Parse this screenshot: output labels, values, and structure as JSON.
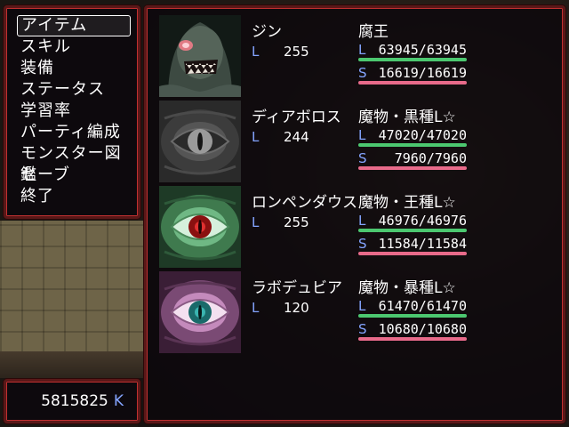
{
  "menu": {
    "items": [
      {
        "label": "アイテム",
        "selected": true
      },
      {
        "label": "スキル",
        "selected": false
      },
      {
        "label": "装備",
        "selected": false
      },
      {
        "label": "ステータス",
        "selected": false
      },
      {
        "label": "学習率",
        "selected": false
      },
      {
        "label": "パーティ編成",
        "selected": false
      },
      {
        "label": "モンスター図鑑",
        "selected": false
      },
      {
        "label": "セーブ",
        "selected": false
      },
      {
        "label": "終了",
        "selected": false
      }
    ]
  },
  "gold": {
    "value": "5815825",
    "unit": "K"
  },
  "party": {
    "members": [
      {
        "name": "ジン",
        "level_label": "L",
        "level": "255",
        "class": "腐王",
        "stat1_label": "L",
        "stat1_value": "63945/63945",
        "stat1_fill": 1.0,
        "stat2_label": "S",
        "stat2_value": "16619/16619",
        "stat2_fill": 1.0,
        "portrait": "masked-monster-face"
      },
      {
        "name": "ディアボロス",
        "level_label": "L",
        "level": "244",
        "class": "魔物・黒種L☆",
        "stat1_label": "L",
        "stat1_value": "47020/47020",
        "stat1_fill": 1.0,
        "stat2_label": "S",
        "stat2_value": "7960/7960",
        "stat2_fill": 1.0,
        "portrait": "grey-eye"
      },
      {
        "name": "ロンペンダウス",
        "level_label": "L",
        "level": "255",
        "class": "魔物・王種L☆",
        "stat1_label": "L",
        "stat1_value": "46976/46976",
        "stat1_fill": 1.0,
        "stat2_label": "S",
        "stat2_value": "11584/11584",
        "stat2_fill": 1.0,
        "portrait": "green-eye"
      },
      {
        "name": "ラボデュビア",
        "level_label": "L",
        "level": "120",
        "class": "魔物・暴種L☆",
        "stat1_label": "L",
        "stat1_value": "61470/61470",
        "stat1_fill": 1.0,
        "stat2_label": "S",
        "stat2_value": "10680/10680",
        "stat2_fill": 1.0,
        "portrait": "pink-eye"
      }
    ]
  },
  "colors": {
    "label_blue": "#84a4ff",
    "l_bar": "#4cc870",
    "s_bar": "#e86a8a",
    "window_border": "#c03030"
  }
}
